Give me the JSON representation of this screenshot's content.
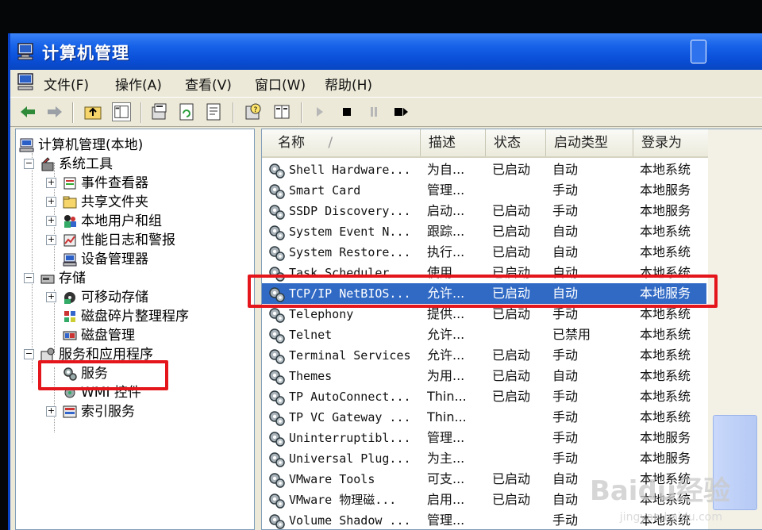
{
  "window": {
    "title": "计算机管理"
  },
  "menu": {
    "items": [
      "文件(F)",
      "操作(A)",
      "查看(V)",
      "窗口(W)",
      "帮助(H)"
    ]
  },
  "toolbar": {
    "icons": [
      "back-arrow-icon",
      "forward-arrow-icon",
      "up-folder-icon",
      "show-hide-tree-icon",
      "properties-icon",
      "refresh-icon",
      "export-list-icon",
      "help-icon",
      "console-icon",
      "play-icon",
      "stop-icon",
      "pause-icon",
      "restart-icon"
    ]
  },
  "tree": {
    "root": "计算机管理(本地)",
    "system_tools": "系统工具",
    "event_viewer": "事件查看器",
    "shared_folders": "共享文件夹",
    "local_users": "本地用户和组",
    "perf_logs": "性能日志和警报",
    "device_manager": "设备管理器",
    "storage": "存储",
    "removable_storage": "可移动存储",
    "defrag": "磁盘碎片整理程序",
    "disk_management": "磁盘管理",
    "services_apps": "服务和应用程序",
    "services": "服务",
    "wmi": "WMI 控件",
    "indexing": "索引服务"
  },
  "list": {
    "columns": [
      "名称",
      "描述",
      "状态",
      "启动类型",
      "登录为"
    ],
    "sort_indicator": "/",
    "selected_index": 6,
    "rows": [
      {
        "name": "Shell Hardware...",
        "desc": "为自...",
        "status": "已启动",
        "startup": "自动",
        "logon": "本地系统"
      },
      {
        "name": "Smart Card",
        "desc": "管理...",
        "status": "",
        "startup": "手动",
        "logon": "本地服务"
      },
      {
        "name": "SSDP Discovery...",
        "desc": "启动...",
        "status": "已启动",
        "startup": "手动",
        "logon": "本地服务"
      },
      {
        "name": "System Event N...",
        "desc": "跟踪...",
        "status": "已启动",
        "startup": "自动",
        "logon": "本地系统"
      },
      {
        "name": "System Restore...",
        "desc": "执行...",
        "status": "已启动",
        "startup": "自动",
        "logon": "本地系统"
      },
      {
        "name": "Task Scheduler",
        "desc": "使用...",
        "status": "已启动",
        "startup": "自动",
        "logon": "本地系统"
      },
      {
        "name": "TCP/IP NetBIOS...",
        "desc": "允许...",
        "status": "已启动",
        "startup": "自动",
        "logon": "本地服务"
      },
      {
        "name": "Telephony",
        "desc": "提供...",
        "status": "已启动",
        "startup": "手动",
        "logon": "本地系统"
      },
      {
        "name": "Telnet",
        "desc": "允许...",
        "status": "",
        "startup": "已禁用",
        "logon": "本地系统"
      },
      {
        "name": "Terminal Services",
        "desc": "允许...",
        "status": "已启动",
        "startup": "手动",
        "logon": "本地系统"
      },
      {
        "name": "Themes",
        "desc": "为用...",
        "status": "已启动",
        "startup": "自动",
        "logon": "本地系统"
      },
      {
        "name": "TP AutoConnect...",
        "desc": "Thin...",
        "status": "已启动",
        "startup": "手动",
        "logon": "本地系统"
      },
      {
        "name": "TP VC Gateway ...",
        "desc": "Thin...",
        "status": "",
        "startup": "手动",
        "logon": "本地系统"
      },
      {
        "name": "Uninterruptibl...",
        "desc": "管理...",
        "status": "",
        "startup": "手动",
        "logon": "本地服务"
      },
      {
        "name": "Universal Plug...",
        "desc": "为主...",
        "status": "",
        "startup": "手动",
        "logon": "本地服务"
      },
      {
        "name": "VMware Tools",
        "desc": "可支...",
        "status": "已启动",
        "startup": "自动",
        "logon": "本地系统"
      },
      {
        "name": "VMware 物理磁...",
        "desc": "启用...",
        "status": "已启动",
        "startup": "自动",
        "logon": "本地系统"
      },
      {
        "name": "Volume Shadow ...",
        "desc": "管理...",
        "status": "",
        "startup": "手动",
        "logon": "本地系统"
      }
    ]
  },
  "watermark": {
    "brand": "Baidu经验",
    "url": "jingyan.baidu.com"
  },
  "colors": {
    "titlebar": "#0a4fd8",
    "selection": "#316ac5",
    "annotation": "#e4161b"
  }
}
